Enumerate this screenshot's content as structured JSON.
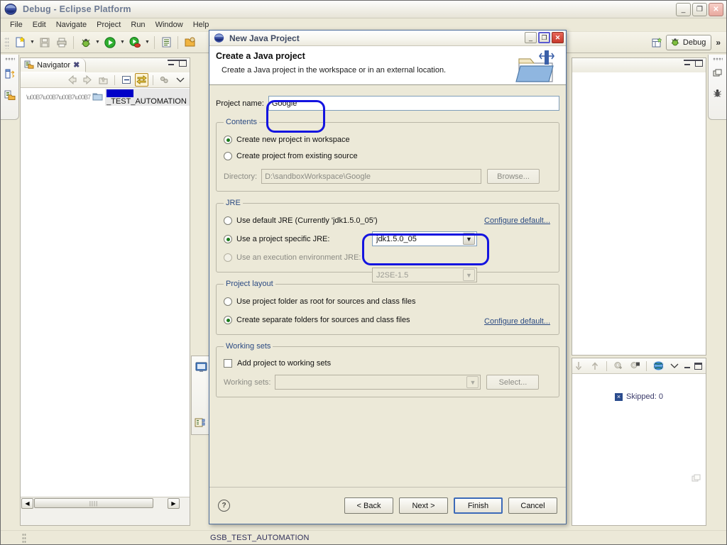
{
  "window": {
    "title": "Debug - Eclipse Platform",
    "logo_icon": "eclipse-logo-icon",
    "minimize_label": "_",
    "restore_label": "❐",
    "close_label": "✕"
  },
  "menu": {
    "items": [
      "File",
      "Edit",
      "Navigate",
      "Project",
      "Run",
      "Window",
      "Help"
    ]
  },
  "toolbar": {
    "buttons": [
      {
        "name": "new-wizard-icon",
        "glyph": "὜B"
      },
      {
        "name": "save-icon",
        "glyph": ""
      },
      {
        "name": "print-icon",
        "glyph": ""
      },
      {
        "name": "debug-icon",
        "glyph": ""
      },
      {
        "name": "run-icon",
        "glyph": ""
      },
      {
        "name": "external-tools-icon",
        "glyph": ""
      },
      {
        "name": "open-task-icon",
        "glyph": ""
      }
    ],
    "perspective": {
      "open_perspective_icon": "open-perspective-icon",
      "current_label": "Debug",
      "current_icon": "debug-perspective-icon",
      "more_label": "»"
    }
  },
  "edge_bars": {
    "left": [
      "properties-view-icon",
      "navigator-fastview-icon"
    ],
    "right": [
      "restore-view-icon",
      "debug-view-icon"
    ]
  },
  "navigator": {
    "tab_label": "Navigator",
    "tab_icon": "navigator-icon",
    "close_label": "✖",
    "toolbar_icons": [
      "back-icon",
      "forward-icon",
      "up-icon",
      "collapse-all-icon",
      "link-with-editor-icon",
      "view-menu-icon",
      "chevron-down-icon"
    ],
    "tree": [
      {
        "icon": "folder-icon",
        "redacted": true,
        "label": "_TEST_AUTOMATION"
      }
    ],
    "scrollbar": {
      "left_arrow": "◀",
      "right_arrow": "▶",
      "grip": "||||"
    }
  },
  "right_views": {
    "top_view": {
      "minimize_label": "–",
      "maximize_label": "❐"
    },
    "junit_view": {
      "toolbar_icons": [
        "down-arrow-icon",
        "up-arrow-icon",
        "next-failure-icon",
        "prev-failure-icon",
        "globe-icon",
        "view-menu-icon",
        "minimize-icon",
        "maximize-icon"
      ],
      "status_text": "Skipped: 0",
      "status_badge": "×"
    }
  },
  "editor_fastviews": [
    "console-view-icon",
    "outline-view-icon"
  ],
  "statusbar": {
    "text": "GSB_TEST_AUTOMATION"
  },
  "dialog": {
    "title": "New Java Project",
    "title_icon": "eclipse-logo-icon",
    "minimize_label": "_",
    "maximize_label": "❐",
    "close_label": "✕",
    "header": {
      "heading": "Create a Java project",
      "subheading": "Create a Java project in the workspace or in an external location.",
      "icon": "new-java-project-icon"
    },
    "project_name": {
      "label": "Project name:",
      "value": "Google",
      "placeholder": ""
    },
    "contents": {
      "legend": "Contents",
      "options": [
        {
          "label": "Create new project in workspace",
          "selected": true
        },
        {
          "label": "Create project from existing source",
          "selected": false
        }
      ],
      "directory": {
        "label": "Directory:",
        "value": "D:\\sandboxWorkspace\\Google",
        "disabled": true,
        "browse_label": "Browse..."
      }
    },
    "jre": {
      "legend": "JRE",
      "options": [
        {
          "label": "Use default JRE (Currently 'jdk1.5.0_05')",
          "selected": false
        },
        {
          "label": "Use a project specific JRE:",
          "selected": true
        },
        {
          "label": "Use an execution environment JRE:",
          "selected": false
        }
      ],
      "specific_jre_value": "jdk1.5.0_05",
      "execution_env_value": "J2SE-1.5",
      "configure_link": "Configure default..."
    },
    "project_layout": {
      "legend": "Project layout",
      "options": [
        {
          "label": "Use project folder as root for sources and class files",
          "selected": false
        },
        {
          "label": "Create separate folders for sources and class files",
          "selected": true
        }
      ],
      "configure_link": "Configure default..."
    },
    "working_sets": {
      "legend": "Working sets",
      "checkbox_label": "Add project to working sets",
      "checked": false,
      "field_label": "Working sets:",
      "field_value": "",
      "select_label": "Select..."
    },
    "footer": {
      "help_label": "?",
      "back_label": "< Back",
      "next_label": "Next >",
      "finish_label": "Finish",
      "cancel_label": "Cancel"
    }
  },
  "annotations": {
    "highlight_color": "#1414e0",
    "rings": [
      "project-name-highlight",
      "jre-combo-highlight"
    ]
  }
}
